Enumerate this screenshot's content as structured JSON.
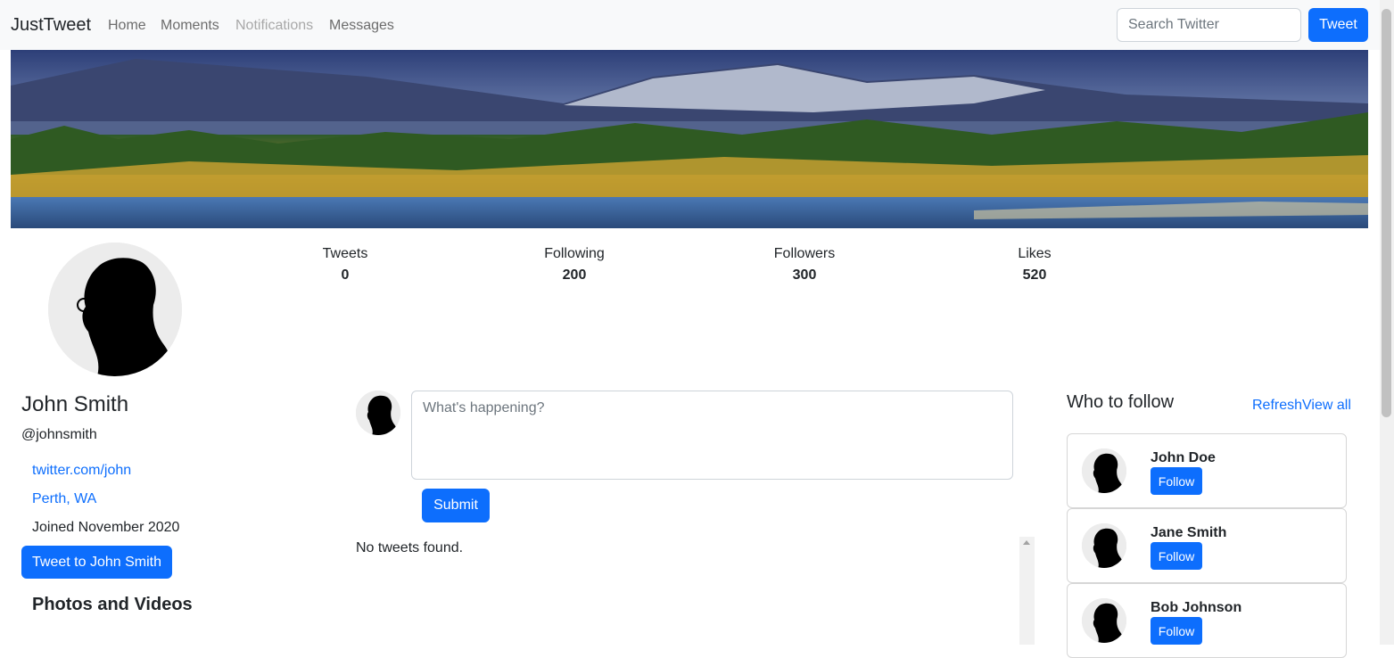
{
  "navbar": {
    "brand": "JustTweet",
    "links": [
      "Home",
      "Moments",
      "Notifications",
      "Messages"
    ],
    "search_placeholder": "Search Twitter",
    "tweet_label": "Tweet"
  },
  "stats": [
    {
      "label": "Tweets",
      "value": "0"
    },
    {
      "label": "Following",
      "value": "200"
    },
    {
      "label": "Followers",
      "value": "300"
    },
    {
      "label": "Likes",
      "value": "520"
    }
  ],
  "profile": {
    "name": "John Smith",
    "handle": "@johnsmith",
    "website": "twitter.com/john",
    "location": "Perth, WA",
    "joined": "Joined November 2020",
    "tweet_to_label": "Tweet to John Smith",
    "photos_heading": "Photos and Videos"
  },
  "compose": {
    "placeholder": "What's happening?",
    "submit_label": "Submit",
    "empty_message": "No tweets found."
  },
  "who_to_follow": {
    "title": "Who to follow",
    "refresh_label": "Refresh",
    "view_all_label": "View all",
    "users": [
      {
        "name": "John Doe",
        "button": "Follow"
      },
      {
        "name": "Jane Smith",
        "button": "Follow"
      },
      {
        "name": "Bob Johnson",
        "button": "Follow"
      }
    ]
  },
  "colors": {
    "primary": "#0d6efd",
    "navbar_bg": "#f8f9fa"
  }
}
